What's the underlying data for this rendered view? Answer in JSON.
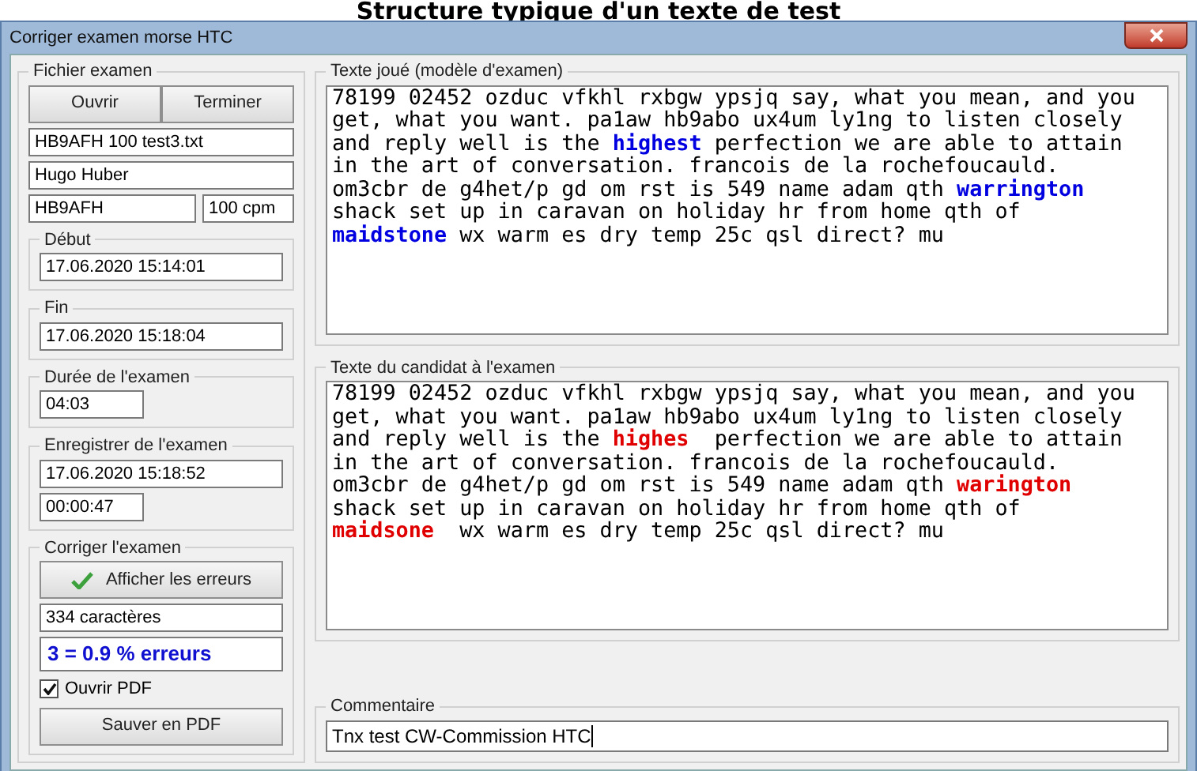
{
  "header": "Structure typique d'un texte de test",
  "window": {
    "title": "Corriger examen morse HTC"
  },
  "file_group": {
    "label": "Fichier examen",
    "buttons": [
      "Ouvrir",
      "Terminer"
    ],
    "file": "HB9AFH 100 test3.txt",
    "name": "Hugo Huber",
    "callsign": "HB9AFH",
    "speed": "100 cpm",
    "groups": [
      {
        "label": "Début",
        "fields": [
          {
            "value": "17.06.2020 15:14:01",
            "kind": "long"
          }
        ]
      },
      {
        "label": "Fin",
        "fields": [
          {
            "value": "17.06.2020 15:18:04",
            "kind": "long"
          }
        ]
      },
      {
        "label": "Durée de l'examen",
        "fields": [
          {
            "value": "04:03",
            "kind": "short"
          }
        ]
      },
      {
        "label": "Enregistrer de l'examen",
        "fields": [
          {
            "value": "17.06.2020 15:18:52",
            "kind": "long"
          },
          {
            "value": "00:00:47",
            "kind": "short"
          }
        ]
      }
    ]
  },
  "correction": {
    "label": "Corriger l'examen",
    "button": "Afficher les erreurs",
    "characters": "334 caractères",
    "errors": "3 = 0.9 % erreurs",
    "open_pdf": {
      "label": "Ouvrir PDF",
      "checked": true
    },
    "save_button": "Sauver en PDF"
  },
  "texts": [
    {
      "label": "Texte joué (modèle d'examen)",
      "kind": "reference",
      "lines": [
        "78199 02452 ozduc vfkhl rxbgw ypsjq say, what you mean, and you",
        "get, what you want. pa1aw hb9abo ux4um ly1ng to listen closely",
        "and reply well is the **highest** perfection we are able to attain",
        "in the art of conversation. francois de la rochefoucauld.",
        "om3cbr de g4het/p gd om rst is 549 name adam qth **warrington**",
        "shack set up in caravan on holiday hr from home qth of",
        "**maidstone** wx warm es dry temp 25c qsl direct? mu"
      ]
    },
    {
      "label": "Texte du candidat à l'examen",
      "kind": "candidate",
      "lines": [
        "78199 02452 ozduc vfkhl rxbgw ypsjq say, what you mean, and you",
        "get, what you want. pa1aw hb9abo ux4um ly1ng to listen closely",
        "and reply well is the **highes**  perfection we are able to attain",
        "in the art of conversation. francois de la rochefoucauld.",
        "om3cbr de g4het/p gd om rst is 549 name adam qth **warington**",
        "shack set up in caravan on holiday hr from home qth of",
        "**maidsone**  wx warm es dry temp 25c qsl direct? mu"
      ]
    }
  ],
  "comment": {
    "label": "Commentaire",
    "value": "Tnx test CW-Commission HTC"
  }
}
